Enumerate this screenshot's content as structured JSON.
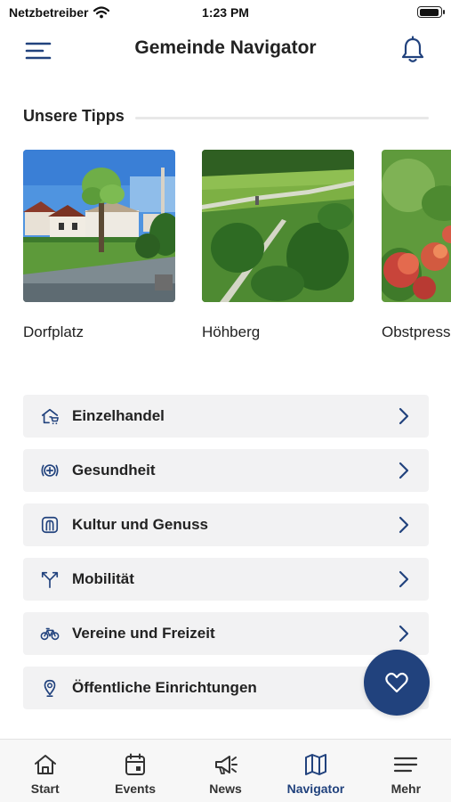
{
  "status_bar": {
    "carrier": "Netzbetreiber",
    "time": "1:23 PM",
    "battery_level": 0.95
  },
  "header": {
    "title": "Gemeinde Navigator",
    "menu_icon": "hamburger-menu-icon",
    "notification_icon": "bell-icon"
  },
  "tips": {
    "heading": "Unsere Tipps",
    "items": [
      {
        "label": "Dorfplatz",
        "image": "village-square-photo"
      },
      {
        "label": "Höhberg",
        "image": "hill-aerial-photo"
      },
      {
        "label": "Obstpresse",
        "image": "apple-tree-photo"
      }
    ]
  },
  "categories": [
    {
      "label": "Einzelhandel",
      "icon": "shop-house-icon"
    },
    {
      "label": "Gesundheit",
      "icon": "medical-cross-icon"
    },
    {
      "label": "Kultur und Genuss",
      "icon": "culture-arch-icon"
    },
    {
      "label": "Mobilität",
      "icon": "split-arrows-icon"
    },
    {
      "label": "Vereine und Freizeit",
      "icon": "bicycle-icon"
    },
    {
      "label": "Öffentliche Einrichtungen",
      "icon": "location-pin-icon"
    }
  ],
  "fab": {
    "icon": "heart-icon"
  },
  "tab_bar": {
    "active": "Navigator",
    "tabs": [
      {
        "label": "Start",
        "icon": "home-icon"
      },
      {
        "label": "Events",
        "icon": "calendar-icon"
      },
      {
        "label": "News",
        "icon": "megaphone-icon"
      },
      {
        "label": "Navigator",
        "icon": "map-icon"
      },
      {
        "label": "Mehr",
        "icon": "menu-lines-icon"
      }
    ]
  },
  "colors": {
    "accent": "#21427d",
    "card_background": "#f2f2f3",
    "tab_bar_background": "#f7f7f7"
  }
}
